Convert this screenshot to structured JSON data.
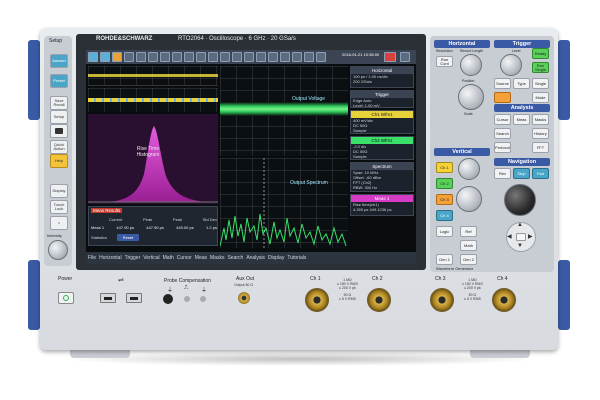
{
  "brand": {
    "logo": "ROHDE&SCHWARZ",
    "model": "RTO2064 · Oscilloscope · 6 GHz · 20 GSa/s"
  },
  "colors": {
    "chassis": "#dde1e6",
    "accent_blue": "#3b5aa6",
    "trace_green": "#3be06a",
    "histogram_magenta": "#d53cc6",
    "trace_yellow": "#e8d23a"
  },
  "screen": {
    "datetime": "2016-01-21 10:38:00",
    "labels": {
      "rise": "Rise Time Histogram",
      "voltage": "Output Voltage",
      "spectrum": "Output Spectrum"
    },
    "side_panels": [
      {
        "title": "Horizontal",
        "lines": [
          "100 ps / 1.00 ns/div",
          "200 GSa/s",
          "100 ns"
        ]
      },
      {
        "title": "Trigger",
        "lines": [
          "Edge  Auto",
          "Level: 1.00 mV"
        ]
      },
      {
        "title": "Ch1 Wfm1",
        "lines": [
          "400 mV/div",
          "DC 50Ω",
          "Sample"
        ]
      },
      {
        "title": "Ch2 Wfm1",
        "lines": [
          "-2.0 div",
          "DC 50Ω",
          "Sample"
        ]
      },
      {
        "title": "Spectrum",
        "lines": [
          "Span: 10 MHz",
          "Offset: -60 dBm",
          "FFT (Ch2)",
          "RBW: 300 Hz"
        ]
      },
      {
        "title": "Meas 1",
        "lines": [
          "Rise time(ch1)",
          "4.269 ps  449.1236 ps"
        ]
      }
    ],
    "meas_table": {
      "title": "Meas Results",
      "headers": [
        "Current",
        "Peak",
        "Peak",
        "Std Dev"
      ],
      "row_label": "Meas 1",
      "row": [
        "447.90 ps",
        "447.90 ps",
        "449.00 ps",
        "1.2 ps"
      ],
      "stats_label": "Statistics",
      "reset": "Reset"
    },
    "menu": [
      "File",
      "Horizontal",
      "Trigger",
      "Vertical",
      "Math",
      "Cursor",
      "Meas",
      "Masks",
      "Search",
      "Analysis",
      "Display",
      "Tutorials"
    ]
  },
  "left_keys": [
    "Setup",
    "Autoset",
    "Preset",
    "Save Recall",
    "Setup",
    "Print",
    "Quick Action",
    "Help",
    "Display",
    "Touch Lock",
    "Intensity",
    "Power"
  ],
  "right_panel": {
    "sections": [
      "Horizontal",
      "Trigger",
      "Analysis",
      "Vertical",
      "Navigation"
    ],
    "horizontal": [
      "Resolution",
      "Record Length",
      "Position",
      "Scale",
      "Run Cont",
      "Run Single"
    ],
    "trigger": [
      "Level",
      "Source",
      "Type",
      "Mode",
      "Single",
      "Ready"
    ],
    "analysis": [
      "Cursor",
      "Meas",
      "Search",
      "History",
      "Protocol",
      "Masks",
      "FFT"
    ],
    "vertical": [
      "Ch 1",
      "Ch 2",
      "Ch 3",
      "Ch 4",
      "Logic",
      "Ref",
      "Math",
      "Gen 1",
      "Gen 2"
    ],
    "navigation": [
      "Rev",
      "Stop",
      "Fwd"
    ],
    "waveform_generator": "Waveform Generator"
  },
  "bottom": {
    "usb_icon": "usb-icon",
    "probe_comp": "Probe Compensation",
    "aux_out": "Aux Out",
    "aux_sub": "Output 50 Ω",
    "power": "Power",
    "channels": [
      "Ch 1",
      "Ch 2",
      "Ch 3",
      "Ch 4"
    ],
    "ch_spec": [
      "1 MΩ",
      "≤ 150 V RMS",
      "≤ 200 V pk",
      "50 Ω",
      "≤ 5 V RMS"
    ]
  }
}
